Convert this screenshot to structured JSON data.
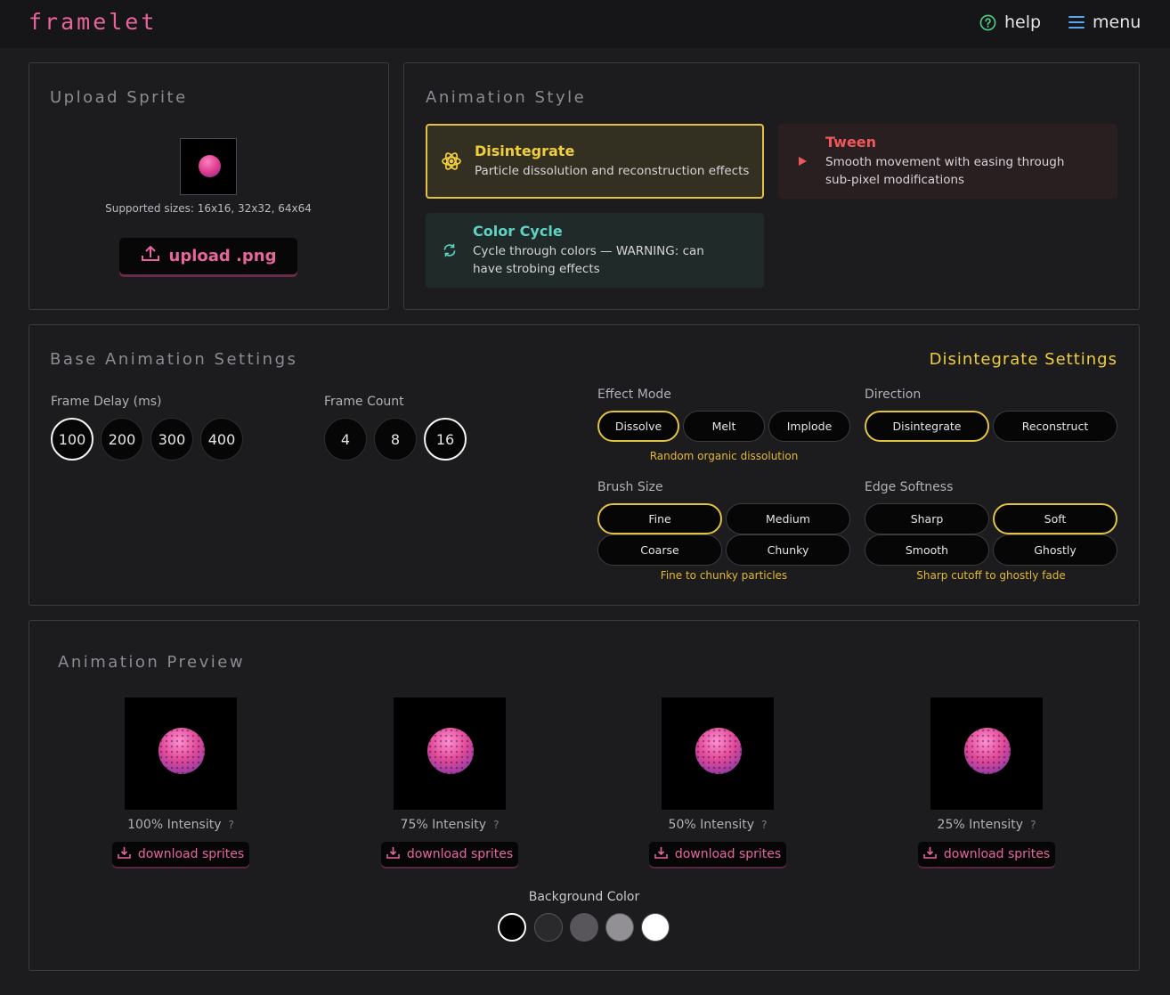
{
  "header": {
    "logo": "framelet",
    "help_label": "help",
    "menu_label": "menu"
  },
  "upload": {
    "title": "Upload Sprite",
    "supported": "Supported sizes: 16x16, 32x32, 64x64",
    "button_label": "upload .png"
  },
  "style": {
    "title": "Animation Style",
    "options": [
      {
        "title": "Disintegrate",
        "desc": "Particle dissolution and reconstruction effects",
        "selected": true,
        "icon": "atom-icon",
        "color": "#f0cf3f"
      },
      {
        "title": "Tween",
        "desc": "Smooth movement with easing through sub-pixel modifications",
        "selected": false,
        "icon": "play-icon",
        "color": "#f0575a"
      },
      {
        "title": "Color Cycle",
        "desc": "Cycle through colors — WARNING: can have strobing effects",
        "selected": false,
        "icon": "refresh-icon",
        "color": "#5fd3c3"
      }
    ]
  },
  "base": {
    "title": "Base Animation Settings",
    "frame_delay_label": "Frame Delay (ms)",
    "frame_delays": [
      "100",
      "200",
      "300",
      "400"
    ],
    "frame_delay_selected": "100",
    "frame_count_label": "Frame Count",
    "frame_counts": [
      "4",
      "8",
      "16"
    ],
    "frame_count_selected": "16"
  },
  "disintegrate": {
    "title": "Disintegrate Settings",
    "effect_mode_label": "Effect Mode",
    "effect_modes": [
      "Dissolve",
      "Melt",
      "Implode"
    ],
    "effect_mode_selected": "Dissolve",
    "effect_mode_hint": "Random organic dissolution",
    "direction_label": "Direction",
    "directions": [
      "Disintegrate",
      "Reconstruct"
    ],
    "direction_selected": "Disintegrate",
    "brush_label": "Brush Size",
    "brushes": [
      "Fine",
      "Medium",
      "Coarse",
      "Chunky"
    ],
    "brush_selected": "Fine",
    "brush_hint": "Fine to chunky particles",
    "edge_label": "Edge Softness",
    "edges": [
      "Sharp",
      "Soft",
      "Smooth",
      "Ghostly"
    ],
    "edge_selected": "Soft",
    "edge_hint": "Sharp cutoff to ghostly fade"
  },
  "preview": {
    "title": "Animation Preview",
    "items": [
      {
        "intensity": "100% Intensity",
        "help": "?",
        "download": "download sprites"
      },
      {
        "intensity": "75% Intensity",
        "help": "?",
        "download": "download sprites"
      },
      {
        "intensity": "50% Intensity",
        "help": "?",
        "download": "download sprites"
      },
      {
        "intensity": "25% Intensity",
        "help": "?",
        "download": "download sprites"
      }
    ],
    "bg_label": "Background Color",
    "bg_colors": [
      "#000000",
      "#2a292c",
      "#58565b",
      "#929095",
      "#ffffff"
    ],
    "bg_selected": 0
  },
  "colors": {
    "accent_pink": "#e8659c",
    "accent_yellow": "#e2c344",
    "help_green": "#4cd08a",
    "menu_blue": "#5aa7ef"
  }
}
